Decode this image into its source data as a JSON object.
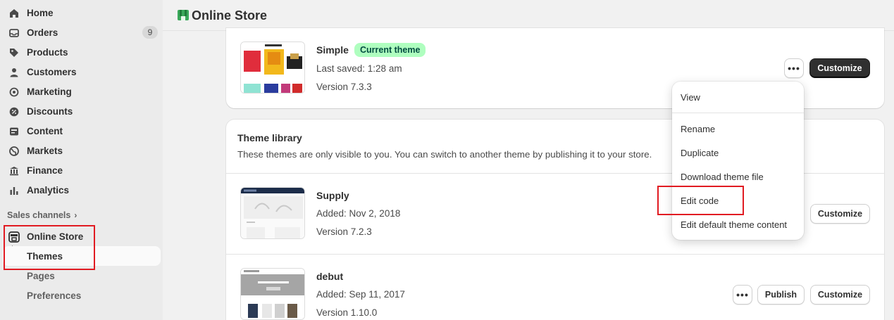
{
  "sidebar": {
    "items": [
      {
        "label": "Home",
        "icon": "home-icon"
      },
      {
        "label": "Orders",
        "icon": "inbox-icon",
        "badge": "9"
      },
      {
        "label": "Products",
        "icon": "tag-icon"
      },
      {
        "label": "Customers",
        "icon": "person-icon"
      },
      {
        "label": "Marketing",
        "icon": "target-icon"
      },
      {
        "label": "Discounts",
        "icon": "discount-icon"
      },
      {
        "label": "Content",
        "icon": "content-icon"
      },
      {
        "label": "Markets",
        "icon": "globe-icon"
      },
      {
        "label": "Finance",
        "icon": "bank-icon"
      },
      {
        "label": "Analytics",
        "icon": "chart-bar-icon"
      }
    ],
    "sales_channels_label": "Sales channels",
    "online_store_label": "Online Store",
    "sub_items": [
      "Themes",
      "Pages",
      "Preferences"
    ]
  },
  "header": {
    "title": "Online Store"
  },
  "current_theme": {
    "name": "Simple",
    "badge": "Current theme",
    "last_saved": "Last saved: 1:28 am",
    "version": "Version 7.3.3",
    "customize_label": "Customize"
  },
  "library": {
    "title": "Theme library",
    "description": "These themes are only visible to you. You can switch to another theme by publishing it to your store.",
    "themes": [
      {
        "name": "Supply",
        "added": "Added: Nov 2, 2018",
        "version": "Version 7.2.3",
        "customize_label": "Customize"
      },
      {
        "name": "debut",
        "added": "Added: Sep 11, 2017",
        "version": "Version 1.10.0",
        "publish_label": "Publish",
        "customize_label": "Customize"
      }
    ]
  },
  "menu": {
    "items": [
      "View",
      "Rename",
      "Duplicate",
      "Download theme file",
      "Edit code",
      "Edit default theme content"
    ]
  },
  "colors": {
    "accent_dark": "#303030",
    "badge_green": "#affebf",
    "highlight_red": "#e11b22"
  }
}
